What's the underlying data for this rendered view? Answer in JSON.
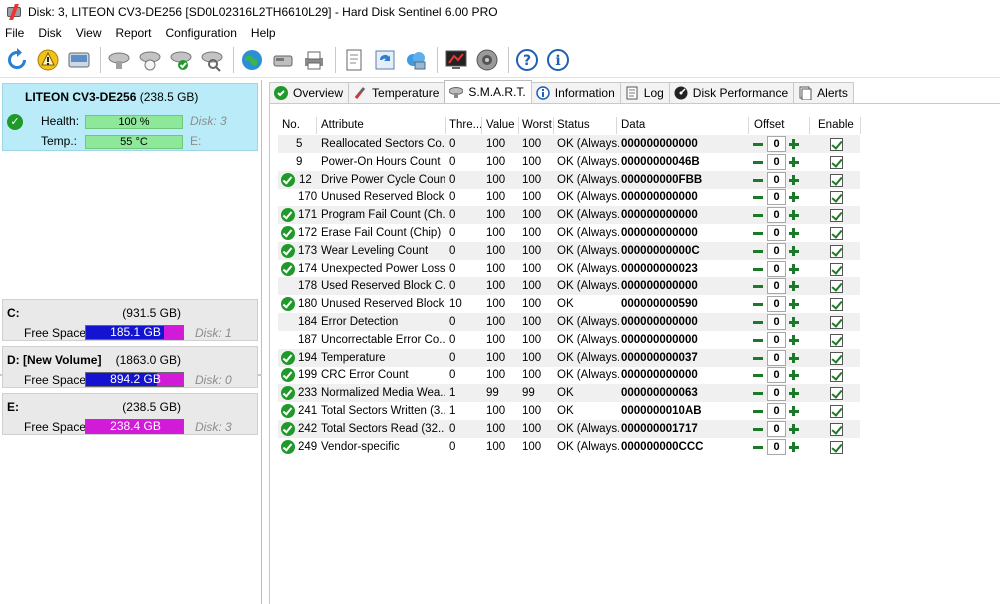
{
  "window": {
    "title": "Disk: 3, LITEON CV3-DE256 [SD0L02316L2TH6610L29]  -  Hard Disk Sentinel 6.00 PRO"
  },
  "menu": [
    "File",
    "Disk",
    "View",
    "Report",
    "Configuration",
    "Help"
  ],
  "toolbar": {
    "icons": [
      "refresh-icon",
      "alert-icon",
      "drive-icon",
      "disk-gray-icon",
      "disk-check-icon",
      "disk-ok-icon",
      "disk-search-icon",
      "globe-icon",
      "network-disk-icon",
      "printer-icon",
      "report-icon",
      "sync-icon",
      "cloud-icon",
      "monitor-icon",
      "speaker-icon",
      "help-icon",
      "info-icon"
    ]
  },
  "disk": {
    "name": "LITEON CV3-DE256",
    "size": "(238.5 GB)",
    "health_label": "Health:",
    "health_value": "100 %",
    "health_fraction": 1.0,
    "health_disk": "Disk: 3",
    "temp_label": "Temp.:",
    "temp_value": "55 °C",
    "temp_drive": "E:"
  },
  "volumes": [
    {
      "letter": "C:",
      "size": "(931.5 GB)",
      "free_label": "Free Space",
      "free": "185.1 GB",
      "used_fraction": 0.8,
      "used_color": "#1414d0",
      "rest_color": "#d21bd8",
      "disk": "Disk: 1"
    },
    {
      "letter": "D: [New Volume]",
      "size": "(1863.0 GB)",
      "free_label": "Free Space",
      "free": "894.2 GB",
      "used_fraction": 0.73,
      "used_color": "#1414d0",
      "rest_color": "#d21bd8",
      "disk": "Disk: 0"
    },
    {
      "letter": "E:",
      "size": "(238.5 GB)",
      "free_label": "Free Space",
      "free": "238.4 GB",
      "used_fraction": 1.0,
      "used_color": "#d21bd8",
      "rest_color": "#d21bd8",
      "disk": "Disk: 3"
    }
  ],
  "tabs": [
    {
      "label": "Overview",
      "icon": "ok-icon",
      "active": false
    },
    {
      "label": "Temperature",
      "icon": "thermometer-icon",
      "active": false
    },
    {
      "label": "S.M.A.R.T.",
      "icon": "disk-smart-icon",
      "active": true
    },
    {
      "label": "Information",
      "icon": "information-icon",
      "active": false
    },
    {
      "label": "Log",
      "icon": "log-icon",
      "active": false
    },
    {
      "label": "Disk Performance",
      "icon": "performance-icon",
      "active": false
    },
    {
      "label": "Alerts",
      "icon": "alerts-icon",
      "active": false
    }
  ],
  "smart": {
    "headers": [
      "No.",
      "Attribute",
      "Thre...",
      "Value",
      "Worst",
      "Status",
      "Data",
      "Offset",
      "Enable"
    ],
    "rows": [
      {
        "no": "5",
        "attr": "Reallocated Sectors Co...",
        "thr": "0",
        "val": "100",
        "worst": "100",
        "status": "OK (Always...",
        "data": "000000000000",
        "ok": false,
        "offset": "0"
      },
      {
        "no": "9",
        "attr": "Power-On Hours Count",
        "thr": "0",
        "val": "100",
        "worst": "100",
        "status": "OK (Always...",
        "data": "00000000046B",
        "ok": false,
        "offset": "0"
      },
      {
        "no": "12",
        "attr": "Drive Power Cycle Count",
        "thr": "0",
        "val": "100",
        "worst": "100",
        "status": "OK (Always...",
        "data": "000000000FBB",
        "ok": true,
        "offset": "0"
      },
      {
        "no": "170",
        "attr": "Unused Reserved Block...",
        "thr": "0",
        "val": "100",
        "worst": "100",
        "status": "OK (Always...",
        "data": "000000000000",
        "ok": false,
        "offset": "0"
      },
      {
        "no": "171",
        "attr": "Program Fail Count (Ch...",
        "thr": "0",
        "val": "100",
        "worst": "100",
        "status": "OK (Always...",
        "data": "000000000000",
        "ok": true,
        "offset": "0"
      },
      {
        "no": "172",
        "attr": "Erase Fail Count (Chip)",
        "thr": "0",
        "val": "100",
        "worst": "100",
        "status": "OK (Always...",
        "data": "000000000000",
        "ok": true,
        "offset": "0"
      },
      {
        "no": "173",
        "attr": "Wear Leveling Count",
        "thr": "0",
        "val": "100",
        "worst": "100",
        "status": "OK (Always...",
        "data": "00000000000C",
        "ok": true,
        "offset": "0"
      },
      {
        "no": "174",
        "attr": "Unexpected Power Loss...",
        "thr": "0",
        "val": "100",
        "worst": "100",
        "status": "OK (Always...",
        "data": "000000000023",
        "ok": true,
        "offset": "0"
      },
      {
        "no": "178",
        "attr": "Used Reserved Block C...",
        "thr": "0",
        "val": "100",
        "worst": "100",
        "status": "OK (Always...",
        "data": "000000000000",
        "ok": false,
        "offset": "0"
      },
      {
        "no": "180",
        "attr": "Unused Reserved Block...",
        "thr": "10",
        "val": "100",
        "worst": "100",
        "status": "OK",
        "data": "000000000590",
        "ok": true,
        "offset": "0"
      },
      {
        "no": "184",
        "attr": "Error Detection",
        "thr": "0",
        "val": "100",
        "worst": "100",
        "status": "OK (Always...",
        "data": "000000000000",
        "ok": false,
        "offset": "0"
      },
      {
        "no": "187",
        "attr": "Uncorrectable Error Co...",
        "thr": "0",
        "val": "100",
        "worst": "100",
        "status": "OK (Always...",
        "data": "000000000000",
        "ok": false,
        "offset": "0"
      },
      {
        "no": "194",
        "attr": "Temperature",
        "thr": "0",
        "val": "100",
        "worst": "100",
        "status": "OK (Always...",
        "data": "000000000037",
        "ok": true,
        "offset": "0"
      },
      {
        "no": "199",
        "attr": "CRC Error Count",
        "thr": "0",
        "val": "100",
        "worst": "100",
        "status": "OK (Always...",
        "data": "000000000000",
        "ok": true,
        "offset": "0"
      },
      {
        "no": "233",
        "attr": "Normalized Media Wea...",
        "thr": "1",
        "val": "99",
        "worst": "99",
        "status": "OK",
        "data": "000000000063",
        "ok": true,
        "offset": "0"
      },
      {
        "no": "241",
        "attr": "Total Sectors Written (3...",
        "thr": "1",
        "val": "100",
        "worst": "100",
        "status": "OK",
        "data": "0000000010AB",
        "ok": true,
        "offset": "0"
      },
      {
        "no": "242",
        "attr": "Total Sectors Read (32...",
        "thr": "0",
        "val": "100",
        "worst": "100",
        "status": "OK (Always...",
        "data": "000000001717",
        "ok": true,
        "offset": "0"
      },
      {
        "no": "249",
        "attr": "Vendor-specific",
        "thr": "0",
        "val": "100",
        "worst": "100",
        "status": "OK (Always...",
        "data": "000000000CCC",
        "ok": true,
        "offset": "0"
      }
    ]
  }
}
